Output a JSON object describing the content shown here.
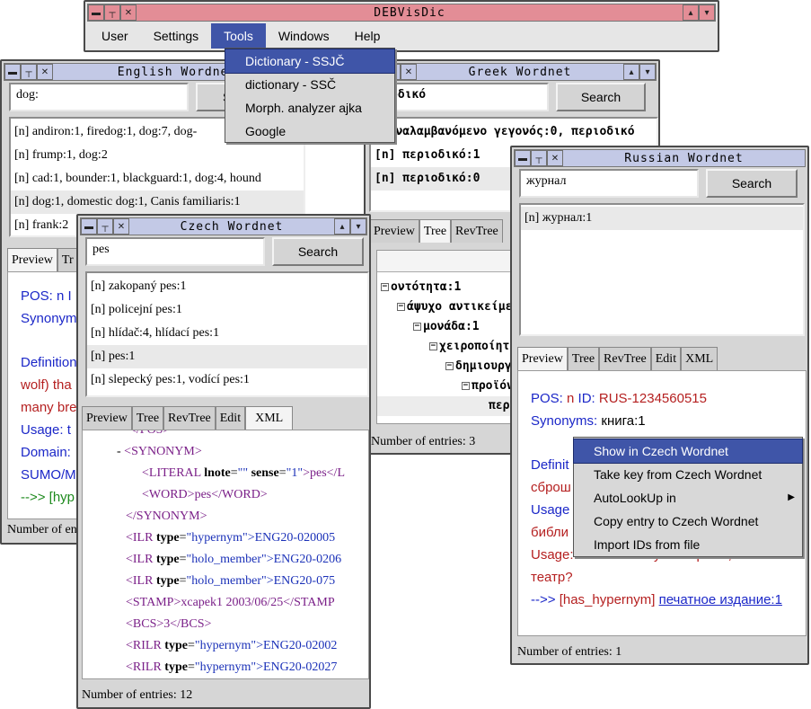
{
  "main_window": {
    "title": "DEBVisDic",
    "menu": [
      "User",
      "Settings",
      "Tools",
      "Windows",
      "Help"
    ]
  },
  "tools_menu": {
    "items": [
      "Dictionary - SSJČ",
      "dictionary - SSČ",
      "Morph. analyzer ajka",
      "Google"
    ]
  },
  "english": {
    "title": "English Wordnet",
    "search_value": "dog:",
    "search_label": "S",
    "results": [
      "[n] andiron:1, firedog:1, dog:7, dog-",
      "[n] frump:1, dog:2",
      "[n] cad:1, bounder:1, blackguard:1, dog:4, hound",
      "[n] dog:1, domestic dog:1, Canis familiaris:1",
      "[n] frank:2"
    ],
    "tabs": [
      "Preview",
      "Tr"
    ],
    "preview": {
      "pos": "POS: n I",
      "synonyms": "Synonym",
      "definition": "Definition",
      "def2": "wolf) tha",
      "def3": "many bre",
      "usage": "Usage: t",
      "domain": "Domain:",
      "sumo": "SUMO/M",
      "hyper": "-->> [hyp"
    },
    "status": "Number of en"
  },
  "greek": {
    "title": "Greek Wordnet",
    "search_value": "οδικό",
    "search_label": "Search",
    "results": [
      "επαναλαμβανόμενο γεγονός:0, περιοδικό",
      "[n] περιοδικό:1",
      "[n] περιοδικό:0"
    ],
    "tabs": [
      "Preview",
      "Tree",
      "RevTree"
    ],
    "tree": [
      "οντότητα:1",
      "άψυχο αντικείμε",
      "μονάδα:1",
      "χειροποίητ",
      "δημιουργ",
      "προϊόν",
      "περ"
    ],
    "status": "Number of entries: 3"
  },
  "czech": {
    "title": "Czech Wordnet",
    "search_value": "pes",
    "search_label": "Search",
    "results": [
      "[n] zakopaný pes:1",
      "[n] policejní pes:1",
      "[n] hlídač:4, hlídací pes:1",
      "[n] pes:1",
      "[n] slepecký pes:1, vodící pes:1"
    ],
    "tabs": [
      "Preview",
      "Tree",
      "RevTree",
      "Edit",
      "XML"
    ],
    "xml": {
      "l0": "</POS>",
      "l1_dash": "- ",
      "l1": "<SYNONYM>",
      "l2_tag": "<LITERAL",
      "l2_a1": "lnote",
      "l2_v1": "\"\"",
      "l2_a2": "sense",
      "l2_v2": "\"1\"",
      "l2_text": "pes",
      "l2_close": "</L",
      "l3_open": "<WORD>",
      "l3_text": "pes",
      "l3_close": "</WORD>",
      "l4": "</SYNONYM>",
      "ilr1_tag": "<ILR",
      "ilr1_attr": "type",
      "ilr1_val": "\"hypernym\"",
      "ilr1_text": ">ENG20-020005",
      "ilr2_tag": "<ILR",
      "ilr2_attr": "type",
      "ilr2_val": "\"holo_member\"",
      "ilr2_text": ">ENG20-0206",
      "ilr3_tag": "<ILR",
      "ilr3_attr": "type",
      "ilr3_val": "\"holo_member\"",
      "ilr3_text": ">ENG20-075",
      "stamp_open": "<STAMP>",
      "stamp_text": "xcapek1 2003/06/25",
      "stamp_close": "</STAMP",
      "bcs_open": "<BCS>",
      "bcs_text": "3",
      "bcs_close": "</BCS>",
      "rilr1_tag": "<RILR",
      "rilr1_attr": "type",
      "rilr1_val": "\"hypernym\"",
      "rilr1_text": ">ENG20-02002",
      "rilr2_tag": "<RILR",
      "rilr2_attr": "type",
      "rilr2_val": "\"hypernym\"",
      "rilr2_text": ">ENG20-02027"
    },
    "status": "Number of entries: 12"
  },
  "russian": {
    "title": "Russian Wordnet",
    "search_value": "журнал",
    "search_label": "Search",
    "results": [
      "[n] журнал:1"
    ],
    "tabs": [
      "Preview",
      "Tree",
      "RevTree",
      "Edit",
      "XML"
    ],
    "preview": {
      "pos_label": "POS:",
      "pos_value": "n",
      "id_label": "ID:",
      "id_value": "RUS-1234560515",
      "syn_label": "Synonyms:",
      "syn_value": "книга:1",
      "def": "Definit",
      "def2": "сброш",
      "usage": "Usage",
      "bibl": "библи",
      "usage2": "Usage: Советы книгу вас время, чтобы",
      "theatre": "театр?",
      "hyper_arrow": "-->>",
      "hyper_rel": "[has_hypernym]",
      "hyper_link": "печатное издание:1"
    },
    "status": "Number of entries: 1"
  },
  "context_menu": {
    "items": [
      "Show in Czech Wordnet",
      "Take key from Czech Wordnet",
      "AutoLookUp in",
      "Copy entry to Czech Wordnet",
      "Import IDs from file"
    ]
  }
}
